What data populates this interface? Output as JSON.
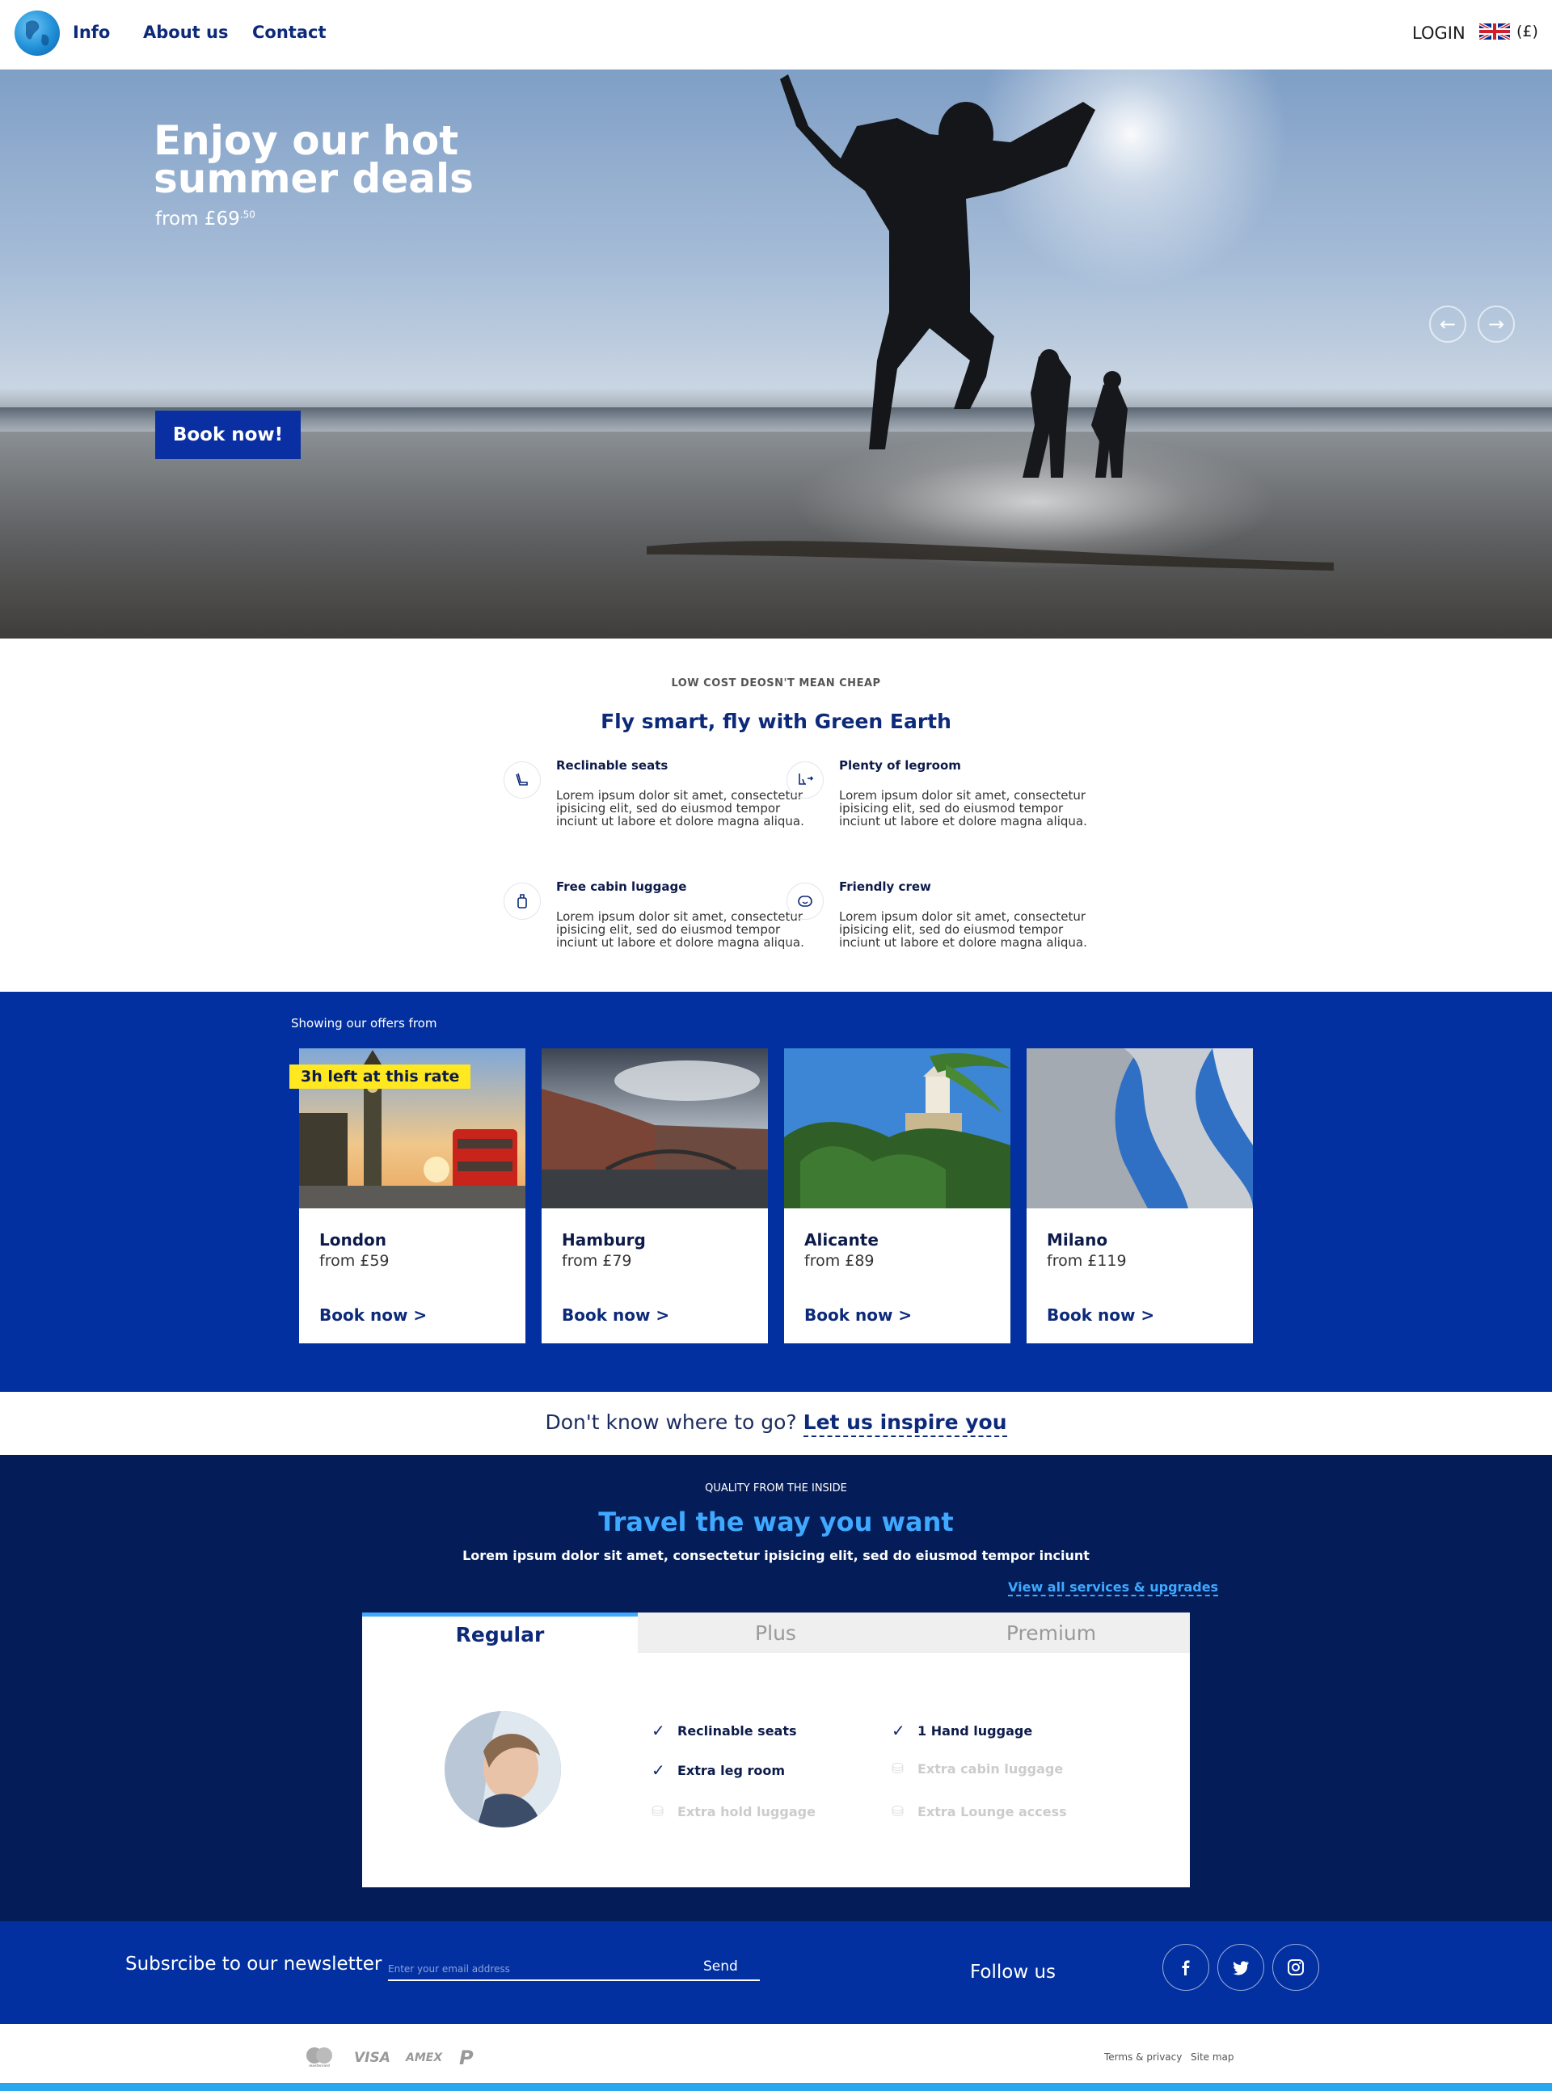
{
  "header": {
    "nav": [
      "Info",
      "About us",
      "Contact"
    ],
    "login": "LOGIN",
    "currency": "(£)"
  },
  "hero": {
    "title_line1": "Enjoy our hot",
    "title_line2": "summer deals",
    "from": "from £69",
    "from_cents": ".50",
    "book": "Book now!",
    "prev_arrow": "←",
    "next_arrow": "→"
  },
  "features": {
    "kicker": "LOW COST DEOSN'T MEAN CHEAP",
    "title": "Fly smart, fly with Green Earth",
    "items": [
      {
        "title": "Reclinable seats",
        "text": "Lorem ipsum dolor sit amet, consectetur ipisicing elit, sed do eiusmod tempor inciunt ut labore et dolore magna aliqua.",
        "icon": "seat-icon"
      },
      {
        "title": "Plenty of legroom",
        "text": "Lorem ipsum dolor sit amet, consectetur ipisicing elit, sed do eiusmod tempor inciunt ut labore et dolore magna aliqua.",
        "icon": "legroom-icon"
      },
      {
        "title": "Free cabin luggage",
        "text": "Lorem ipsum dolor sit amet, consectetur ipisicing elit, sed do eiusmod tempor inciunt ut labore et dolore magna aliqua.",
        "icon": "luggage-icon"
      },
      {
        "title": "Friendly crew",
        "text": "Lorem ipsum dolor sit amet, consectetur ipisicing elit, sed do eiusmod tempor inciunt ut labore et dolore magna aliqua.",
        "icon": "smile-icon"
      }
    ]
  },
  "offers": {
    "label": "Showing our offers from",
    "badge": "3h left at this rate",
    "cards": [
      {
        "city": "London",
        "price": "from £59",
        "book": "Book now >"
      },
      {
        "city": "Hamburg",
        "price": "from £79",
        "book": "Book now >"
      },
      {
        "city": "Alicante",
        "price": "from £89",
        "book": "Book now >"
      },
      {
        "city": "Milano",
        "price": "from £119",
        "book": "Book now >"
      }
    ]
  },
  "inspire": {
    "question": "Don't know where to go?",
    "link": "Let us inspire you"
  },
  "quality": {
    "kicker": "QUALITY FROM THE INSIDE",
    "title": "Travel the way you want",
    "subtitle": "Lorem ipsum dolor sit amet, consectetur ipisicing elit, sed do eiusmod tempor inciunt",
    "link": "View all services & upgrades",
    "tabs": [
      "Regular",
      "Plus",
      "Premium"
    ],
    "benefits": [
      {
        "label": "Reclinable seats",
        "included": true
      },
      {
        "label": "1 Hand luggage",
        "included": true
      },
      {
        "label": "Extra leg room",
        "included": true
      },
      {
        "label": "Extra cabin luggage",
        "included": false
      },
      {
        "label": "Extra hold luggage",
        "included": false
      },
      {
        "label": "Extra Lounge access",
        "included": false
      }
    ]
  },
  "newsletter": {
    "label": "Subsrcibe to our newsletter",
    "placeholder": "Enter your email address",
    "send": "Send",
    "follow": "Follow us",
    "social": [
      "f",
      "t",
      "ig"
    ]
  },
  "footer": {
    "payments": [
      "mastercard",
      "VISA",
      "AMEX",
      "P"
    ],
    "links": [
      "Terms & privacy",
      "Site map"
    ]
  },
  "colors": {
    "brand_blue": "#0330a0",
    "navy": "#041d58",
    "accent": "#3fa8ff",
    "badge_yellow": "#ffe81f"
  }
}
